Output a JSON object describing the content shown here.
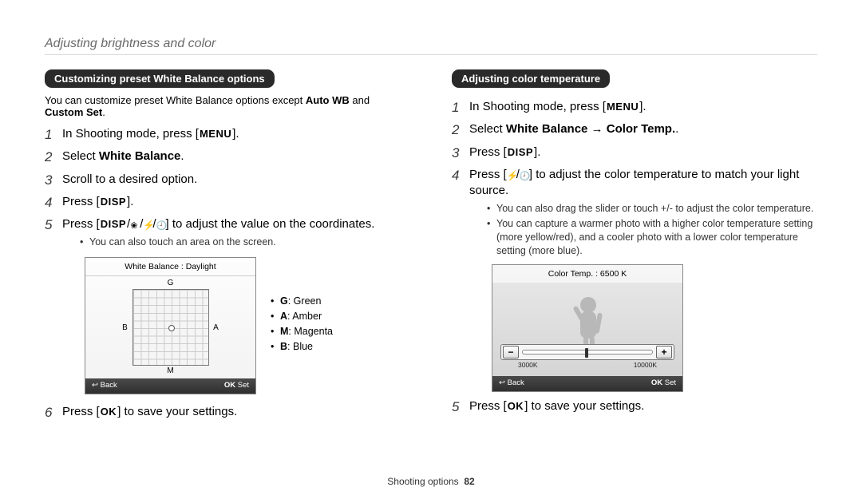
{
  "header": {
    "title": "Adjusting brightness and color"
  },
  "icons": {
    "menu": "MENU",
    "disp": "DISP",
    "ok": "OK",
    "flash": "⚡",
    "macro": "❀",
    "timer": "🕘",
    "back_arrow": "↩",
    "arrow": "→"
  },
  "left": {
    "pill": "Customizing preset White Balance options",
    "intro_a": "You can customize preset White Balance options except ",
    "intro_b1": "Auto WB",
    "intro_mid": " and ",
    "intro_b2": "Custom Set",
    "intro_end": ".",
    "steps": {
      "s1_a": "In Shooting mode, press [",
      "s1_b": "].",
      "s2_a": "Select ",
      "s2_b": "White Balance",
      "s2_c": ".",
      "s3": "Scroll to a desired option.",
      "s4_a": "Press [",
      "s4_b": "].",
      "s5_a": "Press [",
      "s5_b": "] to adjust the value on the coordinates.",
      "s5_sub1": "You can also touch an area on the screen.",
      "s6_a": "Press [",
      "s6_b": "] to save your settings."
    },
    "shot": {
      "title": "White Balance : Daylight",
      "axis": {
        "top": "G",
        "right": "A",
        "bottom": "M",
        "left": "B"
      },
      "bar_back": "Back",
      "bar_set": "Set"
    },
    "legend": {
      "g_k": "G",
      "g_v": ": Green",
      "a_k": "A",
      "a_v": ": Amber",
      "m_k": "M",
      "m_v": ": Magenta",
      "b_k": "B",
      "b_v": ": Blue"
    }
  },
  "right": {
    "pill": "Adjusting color temperature",
    "steps": {
      "s1_a": "In Shooting mode, press [",
      "s1_b": "].",
      "s2_a": "Select ",
      "s2_b": "White Balance",
      "s2_arrow": " → ",
      "s2_c": "Color Temp.",
      "s2_d": ".",
      "s3_a": "Press [",
      "s3_b": "].",
      "s4_a": "Press [",
      "s4_b": "] to adjust the color temperature to match your light source.",
      "s4_sub1": "You can also drag the slider or touch +/- to adjust the color temperature.",
      "s4_sub2": "You can capture a warmer photo with a higher color temperature setting (more yellow/red), and a cooler photo with a lower color temperature setting (more blue).",
      "s5_a": "Press [",
      "s5_b": "] to save your settings."
    },
    "shot": {
      "title": "Color Temp. : 6500 K",
      "minus": "−",
      "plus": "+",
      "scale_min": "3000K",
      "scale_max": "10000K",
      "bar_back": "Back",
      "bar_set": "Set"
    }
  },
  "footer": {
    "section": "Shooting options",
    "page": "82"
  }
}
